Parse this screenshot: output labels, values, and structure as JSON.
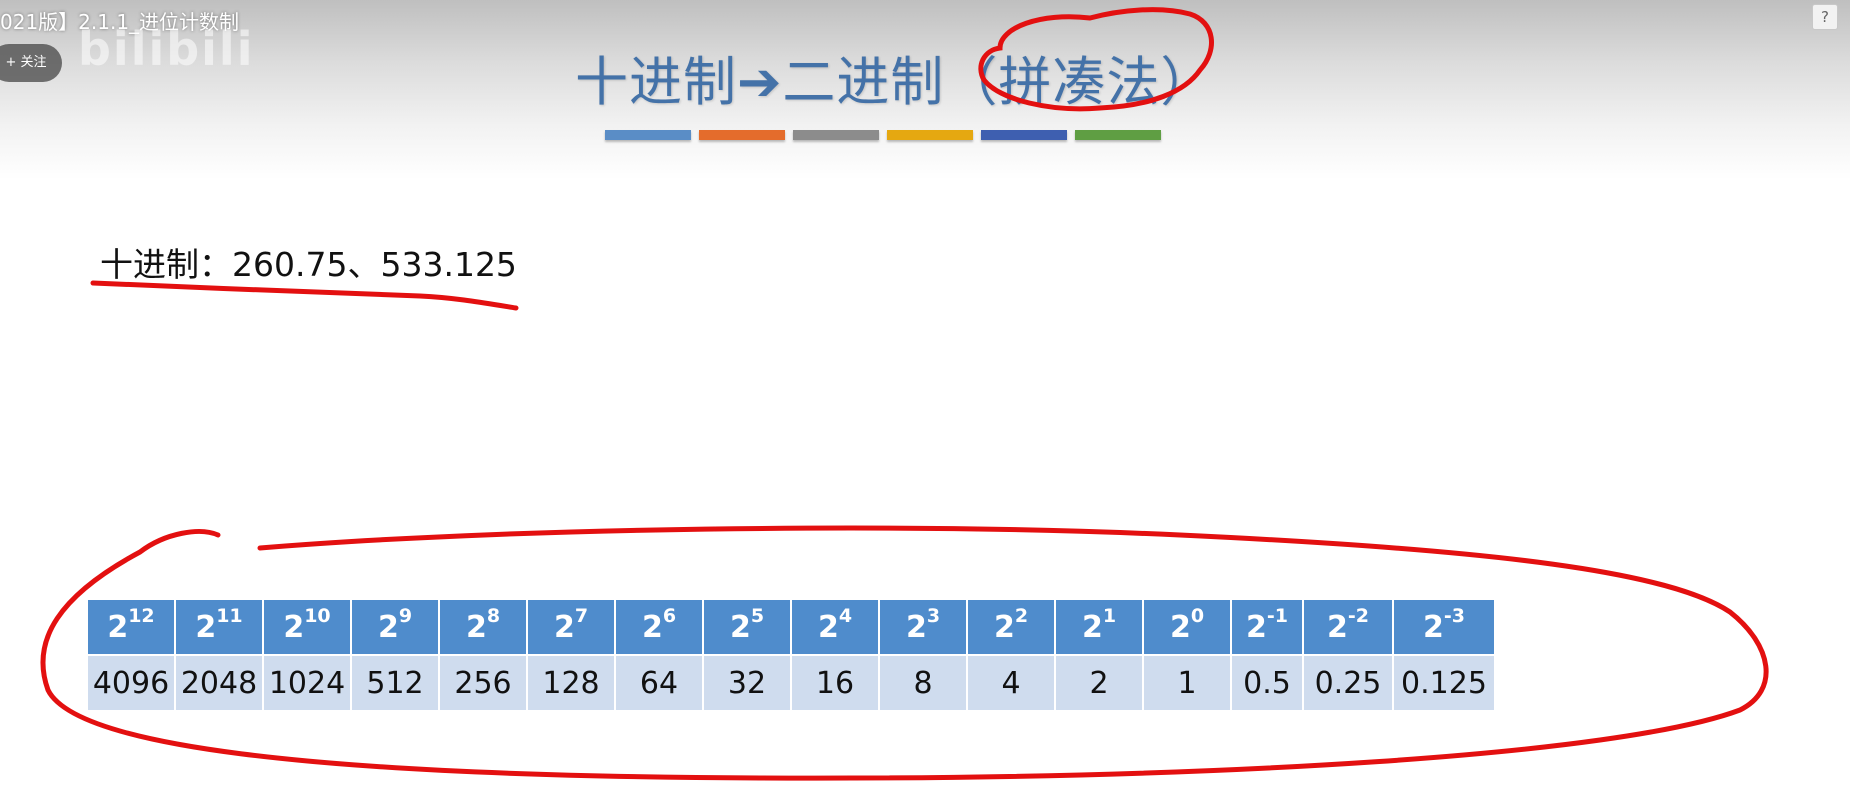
{
  "video": {
    "title": "021版】2.1.1_进位计数制",
    "follow_label": "+ 关注",
    "watermark": "bilibili"
  },
  "slide": {
    "title": "十进制➔二进制（拼凑法）",
    "title_bar_colors": [
      "#5a8dc6",
      "#e46c2c",
      "#8c8c8c",
      "#e5a811",
      "#3e5fb0",
      "#5f9e43"
    ],
    "decimal_text": "十进制：260.75、533.125"
  },
  "table": {
    "bases": [
      "2",
      "2",
      "2",
      "2",
      "2",
      "2",
      "2",
      "2",
      "2",
      "2",
      "2",
      "2",
      "2",
      "2",
      "2",
      "2"
    ],
    "exponents": [
      "12",
      "11",
      "10",
      "9",
      "8",
      "7",
      "6",
      "5",
      "4",
      "3",
      "2",
      "1",
      "0",
      "-1",
      "-2",
      "-3"
    ],
    "values": [
      "4096",
      "2048",
      "1024",
      "512",
      "256",
      "128",
      "64",
      "32",
      "16",
      "8",
      "4",
      "2",
      "1",
      "0.5",
      "0.25",
      "0.125"
    ]
  },
  "annotations": {
    "ink_color": "#e31010"
  }
}
